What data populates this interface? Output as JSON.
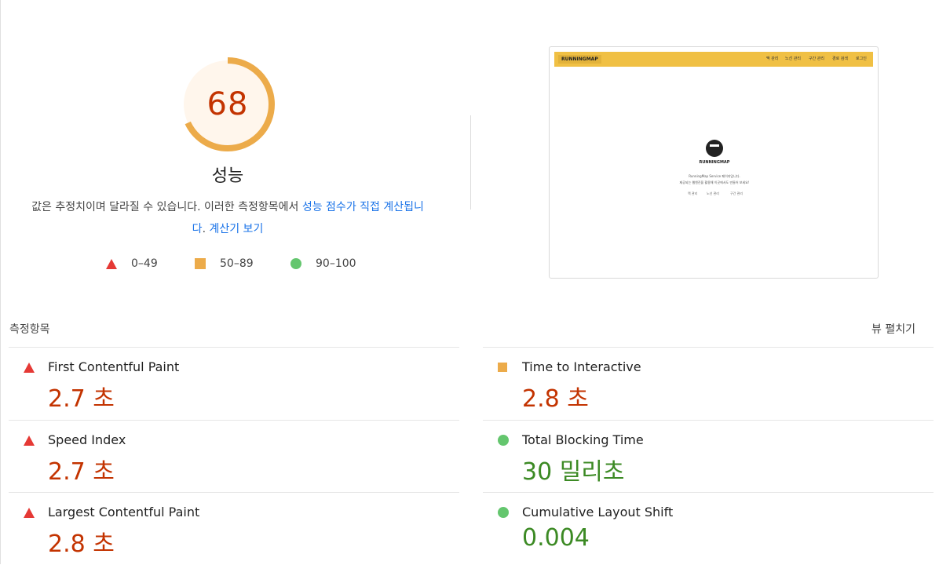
{
  "gauge": {
    "score": "68",
    "score_fraction": 0.68,
    "title": "성능",
    "desc_prefix": "값은 추정치이며 달라질 수 있습니다. 이러한 측정항목에서 ",
    "desc_link1": "성능 점수가 직접 계산됩니다",
    "desc_mid": ". ",
    "desc_link2": "계산기 보기",
    "color": "#ecab4a",
    "bg": "#fff6ec"
  },
  "legend": [
    {
      "range": "0–49",
      "shape": "triangle",
      "color": "#e53935"
    },
    {
      "range": "50–89",
      "shape": "square",
      "color": "#ecab4a"
    },
    {
      "range": "90–100",
      "shape": "circle",
      "color": "#64c66e"
    }
  ],
  "thumbnail": {
    "logo": "RUNNINGMAP",
    "nav": [
      "맥 관리",
      "노선 관리",
      "구간 관리",
      "경로 검색",
      "로그인"
    ],
    "brand": "RUNNINGMAP",
    "line1": "RunningMap Service 페이지입니다.",
    "line2": "제공되는 웹엔진을 활용해 이곳에서도 만들어 보세요!",
    "links": [
      "맥 관리",
      "노선 관리",
      "구간 관리"
    ]
  },
  "metrics_section": {
    "title": "측정항목",
    "expand_label": "뷰 펼치기"
  },
  "metrics": [
    {
      "name": "First Contentful Paint",
      "value": "2.7 초",
      "status": "fail"
    },
    {
      "name": "Time to Interactive",
      "value": "2.8 초",
      "status": "average"
    },
    {
      "name": "Speed Index",
      "value": "2.7 초",
      "status": "fail"
    },
    {
      "name": "Total Blocking Time",
      "value": "30 밀리초",
      "status": "pass"
    },
    {
      "name": "Largest Contentful Paint",
      "value": "2.8 초",
      "status": "fail"
    },
    {
      "name": "Cumulative Layout Shift",
      "value": "0.004",
      "status": "pass"
    }
  ]
}
